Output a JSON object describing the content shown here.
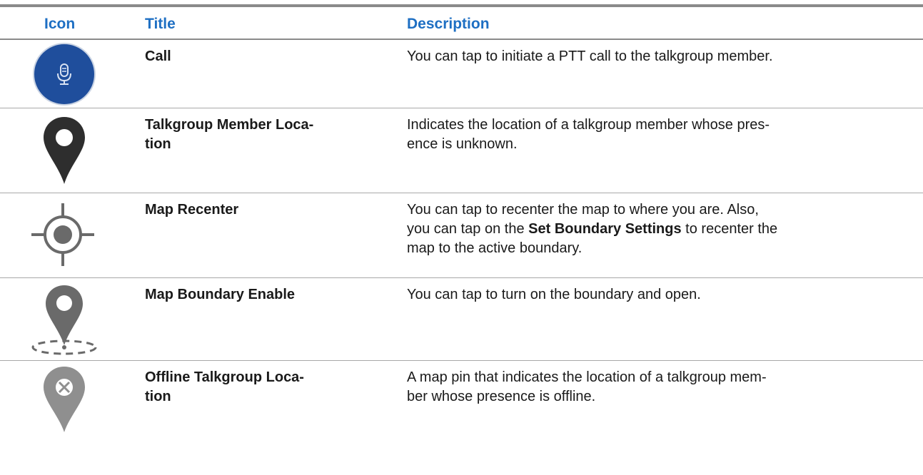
{
  "table": {
    "headers": {
      "icon": "Icon",
      "title": "Title",
      "description": "Description"
    },
    "rows": [
      {
        "icon": "microphone-call-icon",
        "title_lines": [
          "Call"
        ],
        "description_lines": [
          "You can tap to initiate a PTT call to the talkgroup member."
        ]
      },
      {
        "icon": "location-pin-icon",
        "title_lines": [
          "Talkgroup Member Loca-",
          "tion"
        ],
        "description_lines": [
          "Indicates the location of a talkgroup member whose pres-",
          "ence is unknown."
        ]
      },
      {
        "icon": "map-recenter-crosshair-icon",
        "title_lines": [
          "Map Recenter"
        ],
        "description_line1": "You can tap to recenter the map to where you are. Also,",
        "description_line2_pre": "you can tap on the ",
        "description_line2_bold": "Set Boundary Settings",
        "description_line2_post": " to recenter the",
        "description_line3": "map to the active boundary."
      },
      {
        "icon": "map-boundary-pin-icon",
        "title_lines": [
          "Map Boundary Enable"
        ],
        "description_lines": [
          "You can tap to turn on the boundary and open."
        ]
      },
      {
        "icon": "offline-location-pin-icon",
        "title_lines": [
          "Offline Talkgroup Loca-",
          "tion"
        ],
        "description_lines": [
          "A map pin that indicates the location of a talkgroup mem-",
          "ber whose presence is offline."
        ]
      }
    ]
  },
  "colors": {
    "header_text": "#1e6fc3",
    "call_icon_fill": "#1f4e9c",
    "pin_dark": "#2e2e2e",
    "pin_mid": "#6a6a6a",
    "pin_light": "#8f8f8f"
  }
}
